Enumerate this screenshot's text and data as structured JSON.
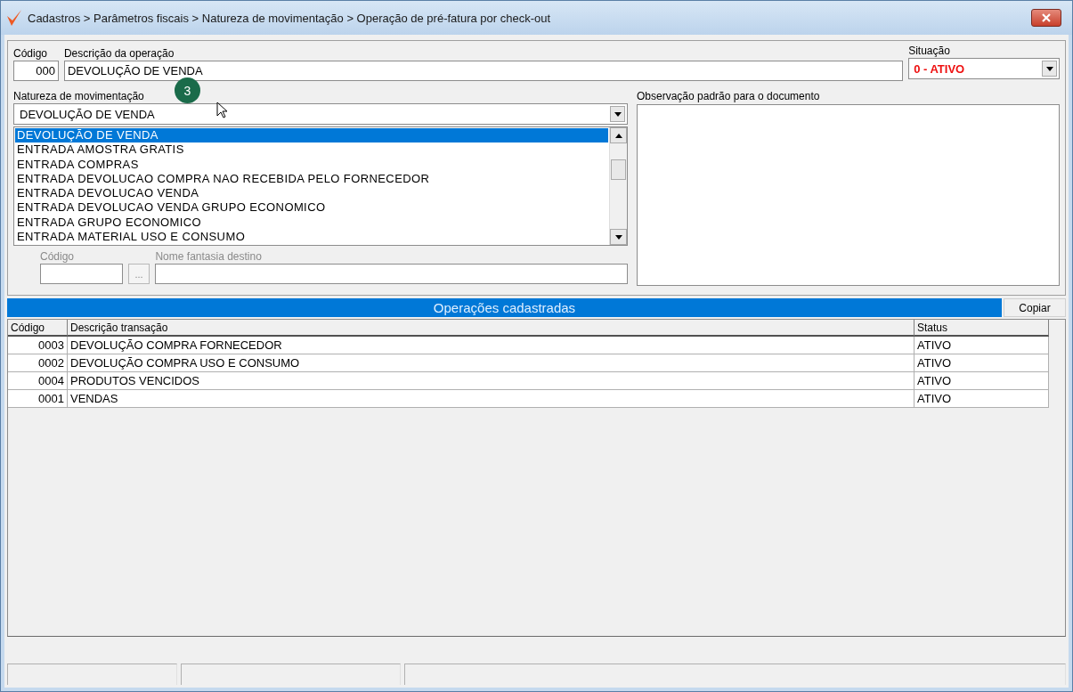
{
  "window": {
    "title": "Cadastros > Parâmetros fiscais > Natureza de movimentação > Operação de pré-fatura por check-out"
  },
  "form": {
    "code_label": "Código",
    "code_value": "000",
    "description_label": "Descrição da operação",
    "description_value": "DEVOLUÇÃO DE VENDA",
    "status_label": "Situação",
    "status_value": "0 - ATIVO",
    "nature_label": "Natureza de movimentação",
    "nature_value": "DEVOLUÇÃO DE VENDA",
    "step_badge": "3",
    "nature_options": [
      {
        "label": "DEVOLUÇÃO DE VENDA",
        "selected": true
      },
      {
        "label": "ENTRADA AMOSTRA GRATIS",
        "selected": false
      },
      {
        "label": "ENTRADA COMPRAS",
        "selected": false
      },
      {
        "label": "ENTRADA DEVOLUCAO COMPRA NAO RECEBIDA PELO FORNECEDOR",
        "selected": false
      },
      {
        "label": "ENTRADA DEVOLUCAO VENDA",
        "selected": false
      },
      {
        "label": "ENTRADA DEVOLUCAO VENDA GRUPO ECONOMICO",
        "selected": false
      },
      {
        "label": "ENTRADA GRUPO ECONOMICO",
        "selected": false
      },
      {
        "label": "ENTRADA MATERIAL USO E CONSUMO",
        "selected": false
      }
    ],
    "dest_code_label": "Código",
    "dest_button": "...",
    "dest_name_label": "Nome fantasia destino",
    "dest_disabled": true,
    "notes_label": "Observação padrão para o documento"
  },
  "operations": {
    "title": "Operações cadastradas",
    "copy_button": "Copiar",
    "columns": [
      "Código",
      "Descrição  transação",
      "Status"
    ],
    "rows": [
      [
        "0003",
        "DEVOLUÇÃO COMPRA FORNECEDOR",
        "ATIVO"
      ],
      [
        "0002",
        "DEVOLUÇÃO COMPRA USO E CONSUMO",
        "ATIVO"
      ],
      [
        "0004",
        "PRODUTOS VENCIDOS",
        "ATIVO"
      ],
      [
        "0001",
        "VENDAS",
        "ATIVO"
      ]
    ]
  }
}
